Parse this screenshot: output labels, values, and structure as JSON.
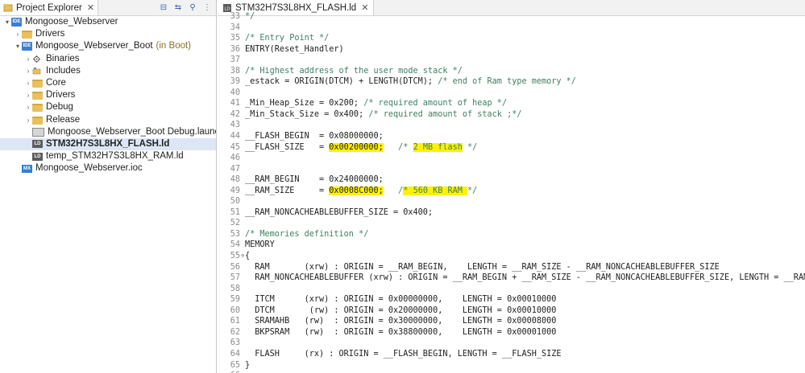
{
  "explorer": {
    "title": "Project Explorer",
    "close": "✕",
    "tools": [
      "⊟",
      "⇆",
      "⚲",
      "⋮"
    ],
    "items": [
      {
        "label": "Mongoose_Webserver",
        "type": "proj",
        "twist": "▾",
        "indent": 0,
        "suffix": ""
      },
      {
        "label": "Drivers",
        "type": "folder",
        "twist": "›",
        "indent": 1,
        "suffix": ""
      },
      {
        "label": "Mongoose_Webserver_Boot",
        "type": "proj",
        "twist": "▾",
        "indent": 1,
        "suffix": "(in Boot)"
      },
      {
        "label": "Binaries",
        "type": "bin",
        "twist": "›",
        "indent": 2,
        "suffix": ""
      },
      {
        "label": "Includes",
        "type": "inc",
        "twist": "›",
        "indent": 2,
        "suffix": ""
      },
      {
        "label": "Core",
        "type": "folder",
        "twist": "›",
        "indent": 2,
        "suffix": ""
      },
      {
        "label": "Drivers",
        "type": "folder",
        "twist": "›",
        "indent": 2,
        "suffix": ""
      },
      {
        "label": "Debug",
        "type": "folder",
        "twist": "›",
        "indent": 2,
        "suffix": ""
      },
      {
        "label": "Release",
        "type": "folder",
        "twist": "›",
        "indent": 2,
        "suffix": ""
      },
      {
        "label": "Mongoose_Webserver_Boot Debug.launch",
        "type": "launch",
        "twist": "",
        "indent": 2,
        "suffix": ""
      },
      {
        "label": "STM32H7S3L8HX_FLASH.ld",
        "type": "ld",
        "twist": "",
        "indent": 2,
        "suffix": "",
        "selected": true
      },
      {
        "label": "temp_STM32H7S3L8HX_RAM.ld",
        "type": "ld",
        "twist": "",
        "indent": 2,
        "suffix": ""
      },
      {
        "label": "Mongoose_Webserver.ioc",
        "type": "mx",
        "twist": "",
        "indent": 1,
        "suffix": ""
      }
    ]
  },
  "editor": {
    "title": "STM32H7S3L8HX_FLASH.ld",
    "close": "✕",
    "lines": [
      {
        "n": "33",
        "parts": [
          {
            "t": "*/",
            "c": "cm"
          }
        ]
      },
      {
        "n": "34",
        "parts": []
      },
      {
        "n": "35",
        "parts": [
          {
            "t": "/* Entry Point */",
            "c": "cm"
          }
        ]
      },
      {
        "n": "36",
        "parts": [
          {
            "t": "ENTRY(Reset_Handler)",
            "c": "tx"
          }
        ]
      },
      {
        "n": "37",
        "parts": []
      },
      {
        "n": "38",
        "parts": [
          {
            "t": "/* Highest address of the user mode stack */",
            "c": "cm"
          }
        ]
      },
      {
        "n": "39",
        "parts": [
          {
            "t": "_estack = ORIGIN(DTCM) + LENGTH(DTCM); ",
            "c": "tx"
          },
          {
            "t": "/* end of Ram type memory */",
            "c": "cm"
          }
        ]
      },
      {
        "n": "40",
        "parts": []
      },
      {
        "n": "41",
        "parts": [
          {
            "t": "_Min_Heap_Size = 0x200; ",
            "c": "tx"
          },
          {
            "t": "/* required amount of heap */",
            "c": "cm"
          }
        ]
      },
      {
        "n": "42",
        "parts": [
          {
            "t": "_Min_Stack_Size = 0x400; ",
            "c": "tx"
          },
          {
            "t": "/* required amount of stack ;*/",
            "c": "cm"
          }
        ]
      },
      {
        "n": "43",
        "parts": []
      },
      {
        "n": "44",
        "parts": [
          {
            "t": "__FLASH_BEGIN  = 0x08000000;",
            "c": "tx"
          }
        ]
      },
      {
        "n": "45",
        "parts": [
          {
            "t": "__FLASH_SIZE   = ",
            "c": "tx"
          },
          {
            "t": "0x00200000;",
            "c": "tx hl"
          },
          {
            "t": "   /* ",
            "c": "cm"
          },
          {
            "t": "2 MB flash",
            "c": "cm hl"
          },
          {
            "t": " */",
            "c": "cm"
          }
        ]
      },
      {
        "n": "46",
        "parts": []
      },
      {
        "n": "47",
        "parts": []
      },
      {
        "n": "48",
        "parts": [
          {
            "t": "__RAM_BEGIN    = 0x24000000;",
            "c": "tx"
          }
        ]
      },
      {
        "n": "49",
        "parts": [
          {
            "t": "__RAM_SIZE     = ",
            "c": "tx"
          },
          {
            "t": "0x0008C000;",
            "c": "tx hl"
          },
          {
            "t": "   /",
            "c": "cm"
          },
          {
            "t": "* 560 KB RAM ",
            "c": "cm hl"
          },
          {
            "t": "*/",
            "c": "cm"
          }
        ]
      },
      {
        "n": "50",
        "parts": []
      },
      {
        "n": "51",
        "parts": [
          {
            "t": "__RAM_NONCACHEABLEBUFFER_SIZE = 0x400;",
            "c": "tx"
          }
        ]
      },
      {
        "n": "52",
        "parts": []
      },
      {
        "n": "53",
        "parts": [
          {
            "t": "/* Memories definition */",
            "c": "cm"
          }
        ]
      },
      {
        "n": "54",
        "parts": [
          {
            "t": "MEMORY",
            "c": "tx"
          }
        ]
      },
      {
        "n": "55",
        "fold": "⊖",
        "parts": [
          {
            "t": "{",
            "c": "tx"
          }
        ]
      },
      {
        "n": "56",
        "parts": [
          {
            "t": "  RAM       (xrw) : ORIGIN = __RAM_BEGIN,    LENGTH = __RAM_SIZE - __RAM_NONCACHEABLEBUFFER_SIZE",
            "c": "tx"
          }
        ]
      },
      {
        "n": "57",
        "parts": [
          {
            "t": "  RAM_NONCACHEABLEBUFFER (xrw) : ORIGIN = __RAM_BEGIN + __RAM_SIZE - __RAM_NONCACHEABLEBUFFER_SIZE, LENGTH = __RAM_N",
            "c": "tx"
          }
        ]
      },
      {
        "n": "58",
        "parts": []
      },
      {
        "n": "59",
        "parts": [
          {
            "t": "  ITCM      (xrw) : ORIGIN = 0x00000000,    LENGTH = 0x00010000",
            "c": "tx"
          }
        ]
      },
      {
        "n": "60",
        "parts": [
          {
            "t": "  DTCM       (rw) : ORIGIN = 0x20000000,    LENGTH = 0x00010000",
            "c": "tx"
          }
        ]
      },
      {
        "n": "61",
        "parts": [
          {
            "t": "  SRAMAHB   (rw)  : ORIGIN = 0x30000000,    LENGTH = 0x00008000",
            "c": "tx"
          }
        ]
      },
      {
        "n": "62",
        "parts": [
          {
            "t": "  BKPSRAM   (rw)  : ORIGIN = 0x38800000,    LENGTH = 0x00001000",
            "c": "tx"
          }
        ]
      },
      {
        "n": "63",
        "parts": []
      },
      {
        "n": "64",
        "parts": [
          {
            "t": "  FLASH     (rx) : ORIGIN = __FLASH_BEGIN, LENGTH = __FLASH_SIZE",
            "c": "tx"
          }
        ]
      },
      {
        "n": "65",
        "parts": [
          {
            "t": "}",
            "c": "tx"
          }
        ]
      },
      {
        "n": "66",
        "parts": []
      }
    ]
  }
}
